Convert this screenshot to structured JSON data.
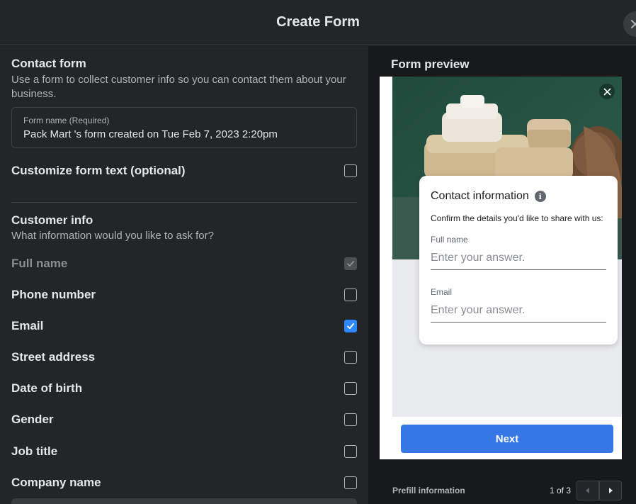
{
  "header": {
    "title": "Create Form"
  },
  "contact": {
    "title": "Contact form",
    "description": "Use a form to collect customer info so you can contact them about your business.",
    "form_name_label": "Form name (Required)",
    "form_name_value": "Pack Mart 's form created on Tue Feb 7, 2023 2:20pm"
  },
  "customize": {
    "label": "Customize form text (optional)",
    "checked": false
  },
  "customer_info": {
    "title": "Customer info",
    "description": "What information would you like to ask for?",
    "fields": [
      {
        "label": "Full name",
        "checked": true,
        "disabled": true
      },
      {
        "label": "Phone number",
        "checked": false
      },
      {
        "label": "Email",
        "checked": true
      },
      {
        "label": "Street address",
        "checked": false
      },
      {
        "label": "Date of birth",
        "checked": false
      },
      {
        "label": "Gender",
        "checked": false
      },
      {
        "label": "Job title",
        "checked": false
      },
      {
        "label": "Company name",
        "checked": false
      }
    ]
  },
  "preview": {
    "title": "Form preview",
    "card_title": "Contact information",
    "card_desc": "Confirm the details you'd like to share with us:",
    "field1_label": "Full name",
    "field1_placeholder": "Enter your answer.",
    "field2_label": "Email",
    "field2_placeholder": "Enter your answer.",
    "next_label": "Next",
    "prefill_label": "Prefill information",
    "page_indicator": "1 of 3"
  },
  "colors": {
    "accent": "#2d88ff",
    "button": "#3578e5",
    "panel": "#242526"
  }
}
